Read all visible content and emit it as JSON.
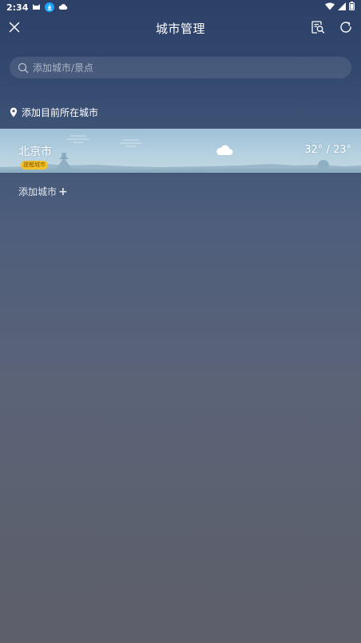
{
  "status_bar": {
    "time": "2:34"
  },
  "header": {
    "title": "城市管理"
  },
  "search": {
    "placeholder": "添加城市/景点"
  },
  "locate": {
    "label": "添加目前所在城市"
  },
  "cities": [
    {
      "name": "北京市",
      "badge": "提醒城市",
      "weather_icon": "cloud-icon",
      "high": "32°",
      "low": "23°",
      "temp_display": "32° / 23°"
    }
  ],
  "add_city": {
    "label": "添加城市",
    "plus": "+"
  },
  "colors": {
    "badge_bg": "#f2c12e",
    "card_sky": "#b4d0e0"
  }
}
